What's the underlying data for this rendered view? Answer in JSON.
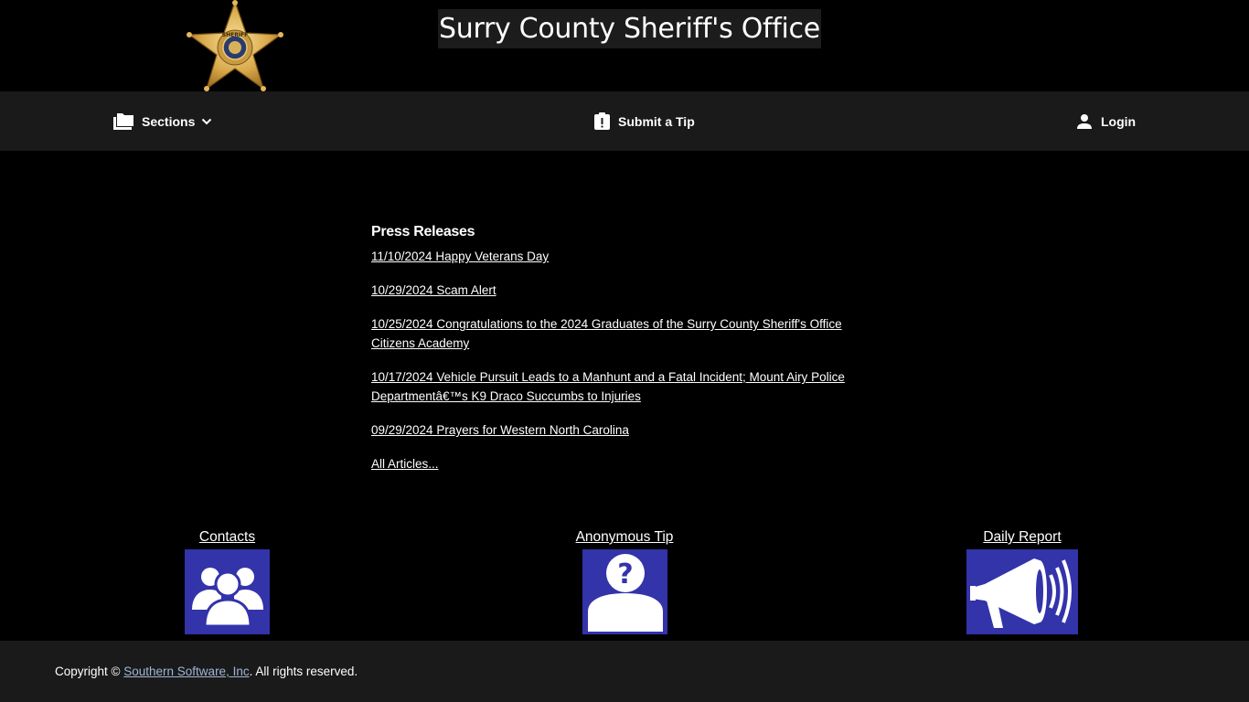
{
  "header": {
    "title": "Surry County Sheriff's Office",
    "logo_icon": "sheriff-star-badge-icon",
    "logo_badge_text": "SHERIFF"
  },
  "nav": {
    "sections_label": "Sections",
    "sections_icon": "folder-icon",
    "tip_label": "Submit a Tip",
    "tip_icon": "clipboard-alert-icon",
    "login_label": "Login",
    "login_icon": "person-icon"
  },
  "press": {
    "heading": "Press Releases",
    "items": [
      "11/10/2024 Happy Veterans Day",
      "10/29/2024 Scam Alert",
      "10/25/2024 Congratulations to the 2024 Graduates of the Surry County Sheriff's Office Citizens Academy",
      "10/17/2024 Vehicle Pursuit Leads to a Manhunt and a Fatal Incident; Mount Airy Police Departmentâ€™s K9 Draco Succumbs to Injuries",
      "09/29/2024 Prayers for Western North Carolina"
    ],
    "all_articles": "All Articles..."
  },
  "quick_links": {
    "contacts": "Contacts",
    "anonymous_tip": "Anonymous Tip",
    "daily_report": "Daily Report",
    "tile_color": "#3333aa"
  },
  "footer": {
    "copyright_prefix": "Copyright ©",
    "company": "Southern Software, Inc",
    "suffix": ". All rights reserved."
  }
}
